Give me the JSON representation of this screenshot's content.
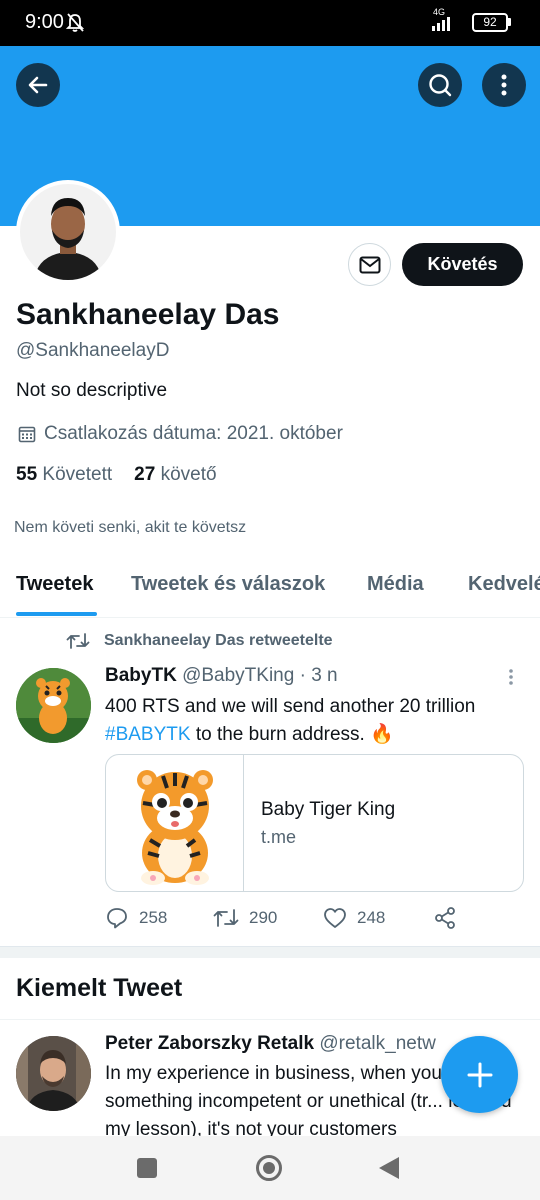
{
  "status_bar": {
    "time": "9:00",
    "network": "4G",
    "battery": "92"
  },
  "profile": {
    "name": "Sankhaneelay Das",
    "handle": "@SankhaneelayD",
    "bio": "Not so descriptive",
    "joined": "Csatlakozás dátuma: 2021. október",
    "following_count": "55",
    "following_label": "Követett",
    "followers_count": "27",
    "followers_label": "követő",
    "not_followed_note": "Nem követi senki, akit te követsz",
    "follow_button": "Követés"
  },
  "tabs": [
    "Tweetek",
    "Tweetek és válaszok",
    "Média",
    "Kedvelé"
  ],
  "retweet": {
    "retweeted_by": "Sankhaneelay Das retweetelte",
    "author_name": "BabyTK",
    "author_handle": "@BabyTKing",
    "time": "· 3 n",
    "text_before": "400 RTS and we will send another 20 trillion",
    "hashtag": "#BABYTK",
    "text_after": " to the burn address. 🔥",
    "card_title": "Baby Tiger King",
    "card_domain": "t.me",
    "replies": "258",
    "retweets": "290",
    "likes": "248"
  },
  "pinned_section": {
    "title": "Kiemelt Tweet"
  },
  "pinned_tweet": {
    "author_name": "Peter Zaborszky Retalk",
    "author_handle": "@retalk_netw",
    "text": "In my experience in business, when you do something incompetent or unethical (tr... learned my lesson), it's not your customers"
  },
  "colors": {
    "accent": "#1d9bf0",
    "text": "#0f1419",
    "secondary": "#536471"
  }
}
